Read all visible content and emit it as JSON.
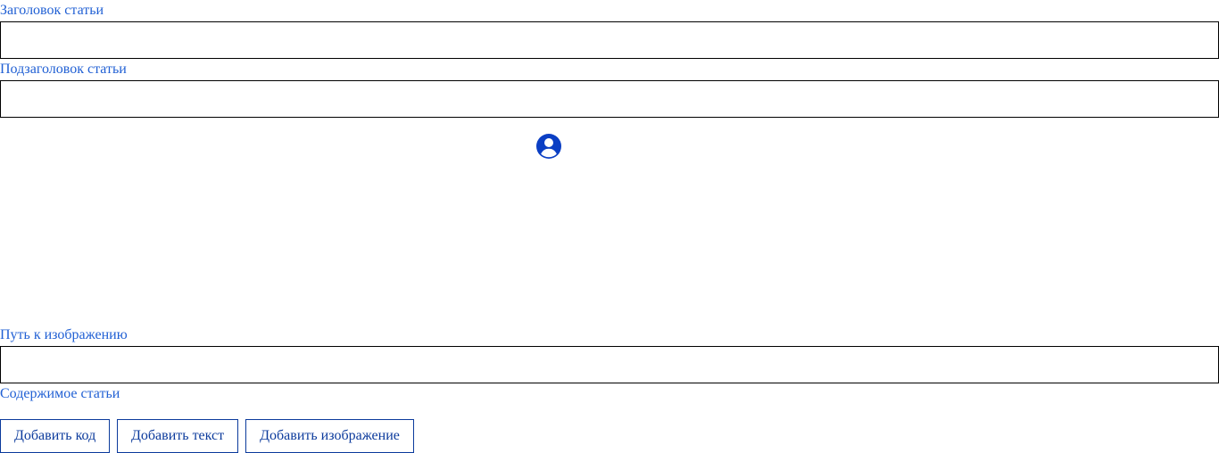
{
  "form": {
    "title_label": "Заголовок статьи",
    "title_value": "",
    "subtitle_label": "Подзаголовок статьи",
    "subtitle_value": "",
    "image_icon": "user-circle-icon",
    "image_path_label": "Путь к изображению",
    "image_path_value": "",
    "content_label": "Содержимое статьи"
  },
  "buttons": {
    "add_code": "Добавить код",
    "add_text": "Добавить текст",
    "add_image": "Добавить изображение"
  },
  "colors": {
    "label": "#2160d4",
    "button": "#0b3a9c",
    "icon": "#0b3fc4"
  }
}
